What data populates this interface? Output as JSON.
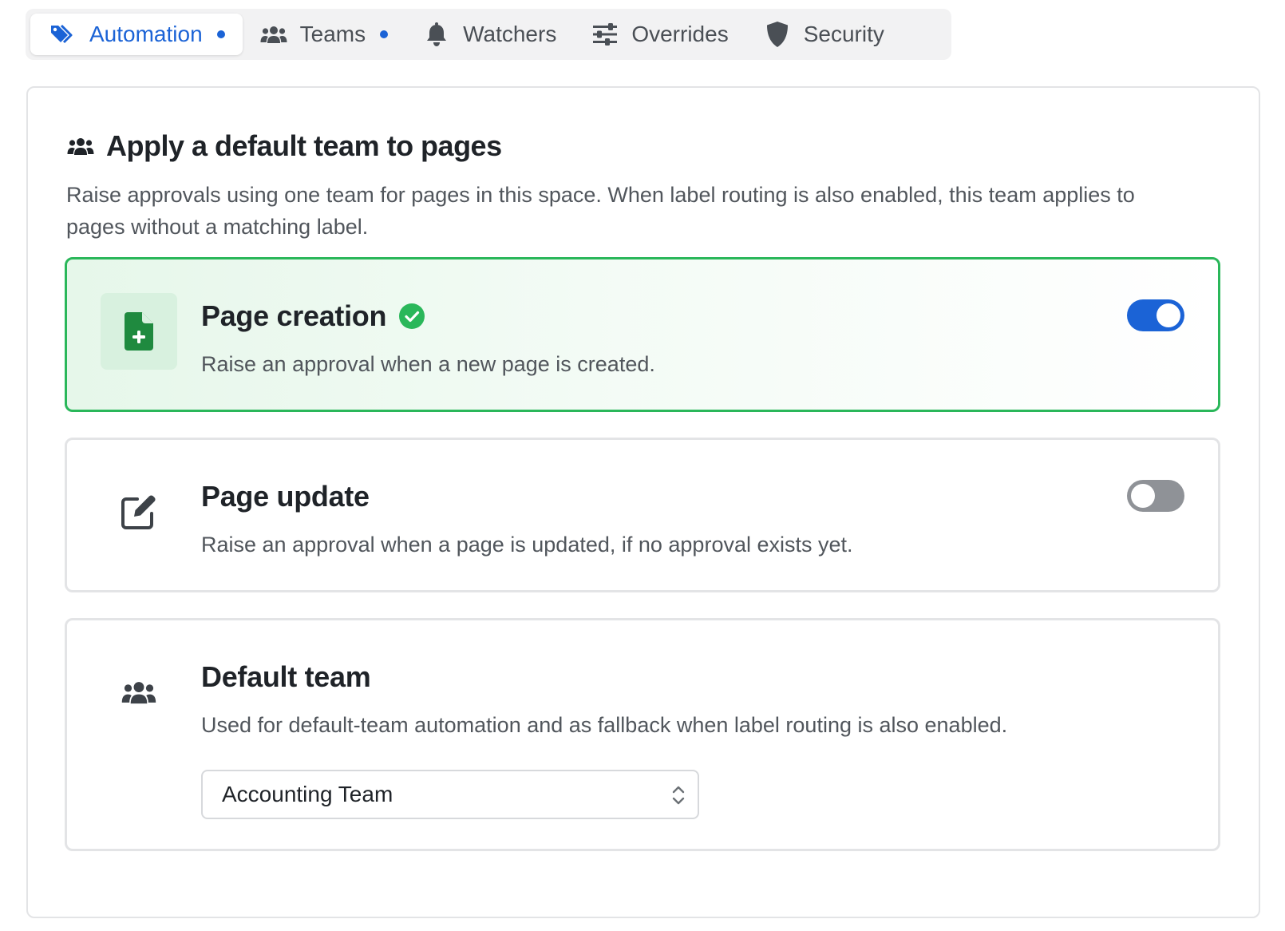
{
  "tabs": [
    {
      "label": "Automation",
      "icon": "tags-icon",
      "active": true,
      "dot": true
    },
    {
      "label": "Teams",
      "icon": "users-icon",
      "active": false,
      "dot": true
    },
    {
      "label": "Watchers",
      "icon": "bell-icon",
      "active": false,
      "dot": false
    },
    {
      "label": "Overrides",
      "icon": "sliders-icon",
      "active": false,
      "dot": false
    },
    {
      "label": "Security",
      "icon": "shield-icon",
      "active": false,
      "dot": false
    }
  ],
  "section": {
    "icon": "users-icon",
    "title": "Apply a default team to pages",
    "description": "Raise approvals using one team for pages in this space. When label routing is also enabled, this team applies to pages without a matching label."
  },
  "options": {
    "page_creation": {
      "icon": "file-plus-icon",
      "title": "Page creation",
      "status": "check-circle-icon",
      "description": "Raise an approval when a new page is created.",
      "enabled": true
    },
    "page_update": {
      "icon": "edit-icon",
      "title": "Page update",
      "description": "Raise an approval when a page is updated, if no approval exists yet.",
      "enabled": false
    },
    "default_team": {
      "icon": "users-icon",
      "title": "Default team",
      "description": "Used for default-team automation and as fallback when label routing is also enabled.",
      "selected": "Accounting Team"
    }
  },
  "colors": {
    "accent": "#1b63d6",
    "success": "#2ab75a",
    "toggle_off": "#8f9297"
  }
}
